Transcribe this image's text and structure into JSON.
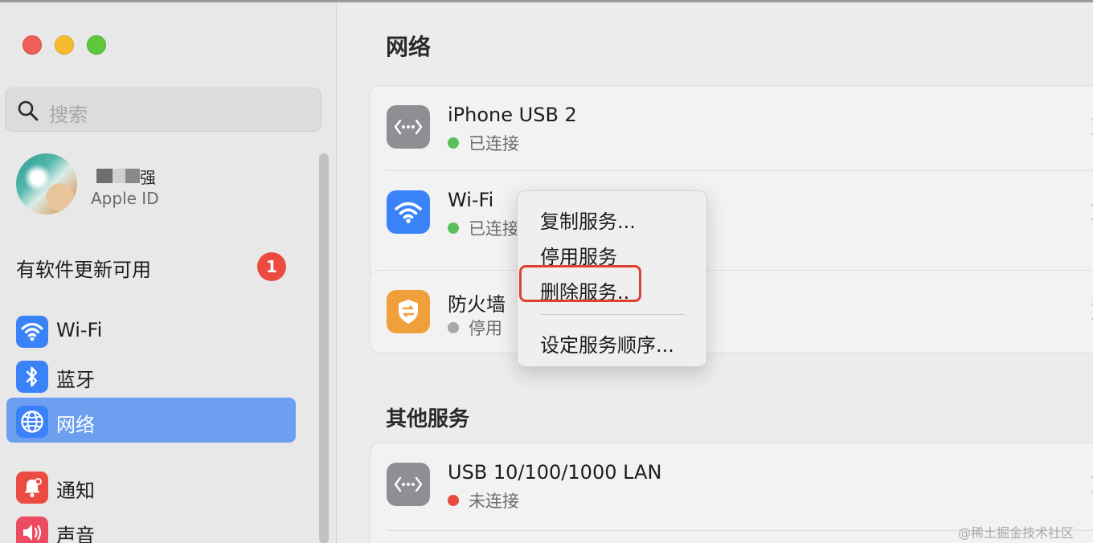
{
  "sidebar": {
    "search_placeholder": "搜索",
    "user": {
      "name": "强",
      "subtitle": "Apple ID"
    },
    "update": {
      "label": "有软件更新可用",
      "badge": "1"
    },
    "nav": [
      {
        "label": "Wi-Fi",
        "icon": "wifi-icon",
        "color": "#3a82f7"
      },
      {
        "label": "蓝牙",
        "icon": "bluetooth-icon",
        "color": "#3a82f7"
      },
      {
        "label": "网络",
        "icon": "globe-icon",
        "color": "#3a82f7",
        "selected": true
      },
      {
        "label": "通知",
        "icon": "bell-icon",
        "color": "#ec4b41"
      },
      {
        "label": "声音",
        "icon": "speaker-icon",
        "color": "#ec4b61"
      }
    ]
  },
  "main": {
    "title": "网络",
    "services": [
      {
        "name": "iPhone USB 2",
        "status": "已连接",
        "status_color": "#5ac05a",
        "icon": "ethernet-icon"
      },
      {
        "name": "Wi-Fi",
        "status": "已连接",
        "status_color": "#5ac05a",
        "icon": "wifi-icon"
      },
      {
        "name": "防火墙",
        "status": "停用",
        "status_color": "#a8a8a8",
        "icon": "firewall-icon"
      }
    ],
    "other_title": "其他服务",
    "other_services": [
      {
        "name": "USB 10/100/1000 LAN",
        "status": "未连接",
        "status_color": "#ea4a3f",
        "icon": "ethernet-icon"
      }
    ]
  },
  "context_menu": {
    "items": [
      "复制服务...",
      "停用服务",
      "删除服务..",
      "设定服务顺序..."
    ],
    "highlighted": "删除服务.."
  },
  "watermark": "@稀土掘金技术社区",
  "colors": {
    "selection": "#6d9ff0",
    "highlight_box": "#e0402f",
    "badge": "#ea4a3f"
  }
}
